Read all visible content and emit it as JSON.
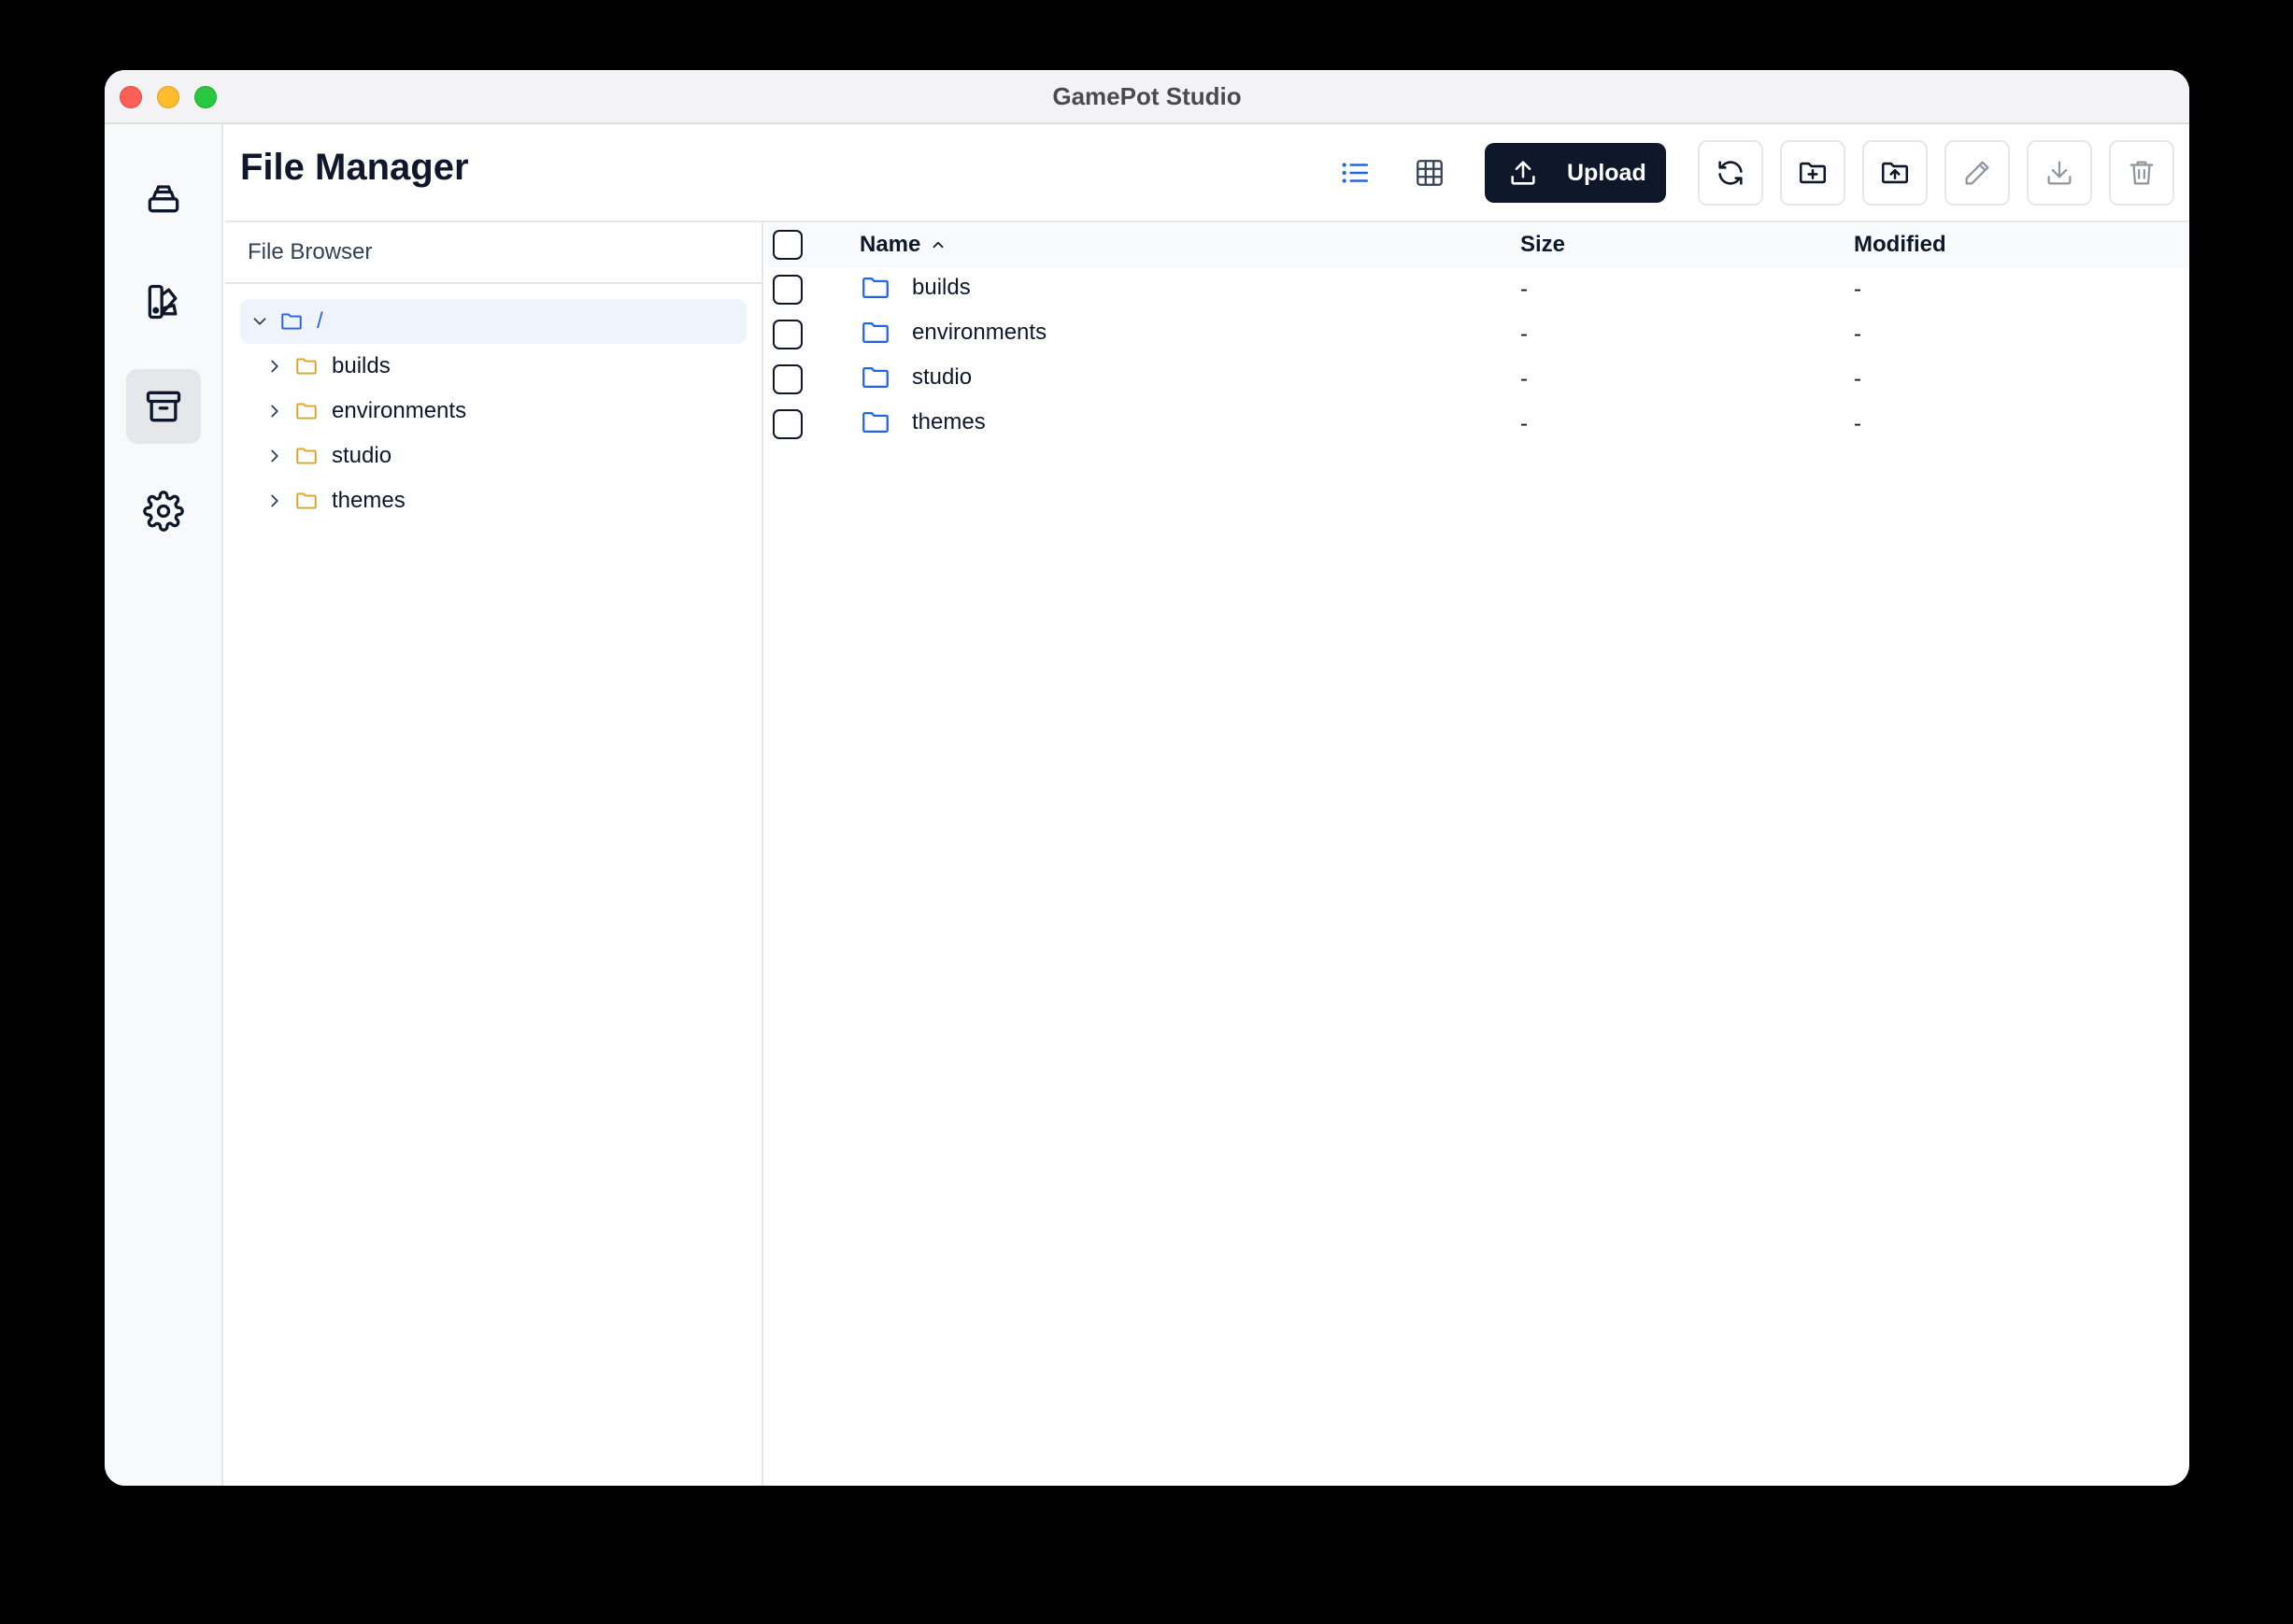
{
  "window": {
    "title": "GamePot Studio"
  },
  "rail": {
    "items": [
      {
        "icon": "database-stack-icon",
        "active": false
      },
      {
        "icon": "palette-swatch-icon",
        "active": false
      },
      {
        "icon": "archive-box-icon",
        "active": true
      },
      {
        "icon": "gear-icon",
        "active": false
      }
    ]
  },
  "header": {
    "title": "File Manager",
    "toolbar": {
      "list_view_icon": "list-icon",
      "grid_view_icon": "grid-icon",
      "upload_label": "Upload",
      "actions": [
        "refresh-icon",
        "new-folder-icon",
        "upload-folder-icon",
        "rename-pencil-icon",
        "download-icon",
        "trash-icon"
      ]
    }
  },
  "browser": {
    "header": "File Browser",
    "root": "/",
    "folders": [
      "builds",
      "environments",
      "studio",
      "themes"
    ]
  },
  "table": {
    "columns": {
      "name": "Name",
      "size": "Size",
      "modified": "Modified"
    },
    "rows": [
      {
        "name": "builds",
        "size": "-",
        "modified": "-"
      },
      {
        "name": "environments",
        "size": "-",
        "modified": "-"
      },
      {
        "name": "studio",
        "size": "-",
        "modified": "-"
      },
      {
        "name": "themes",
        "size": "-",
        "modified": "-"
      }
    ]
  },
  "colors": {
    "accent": "#2563eb",
    "tree_folder": "#e0a526",
    "primary_dark": "#0f172a"
  }
}
